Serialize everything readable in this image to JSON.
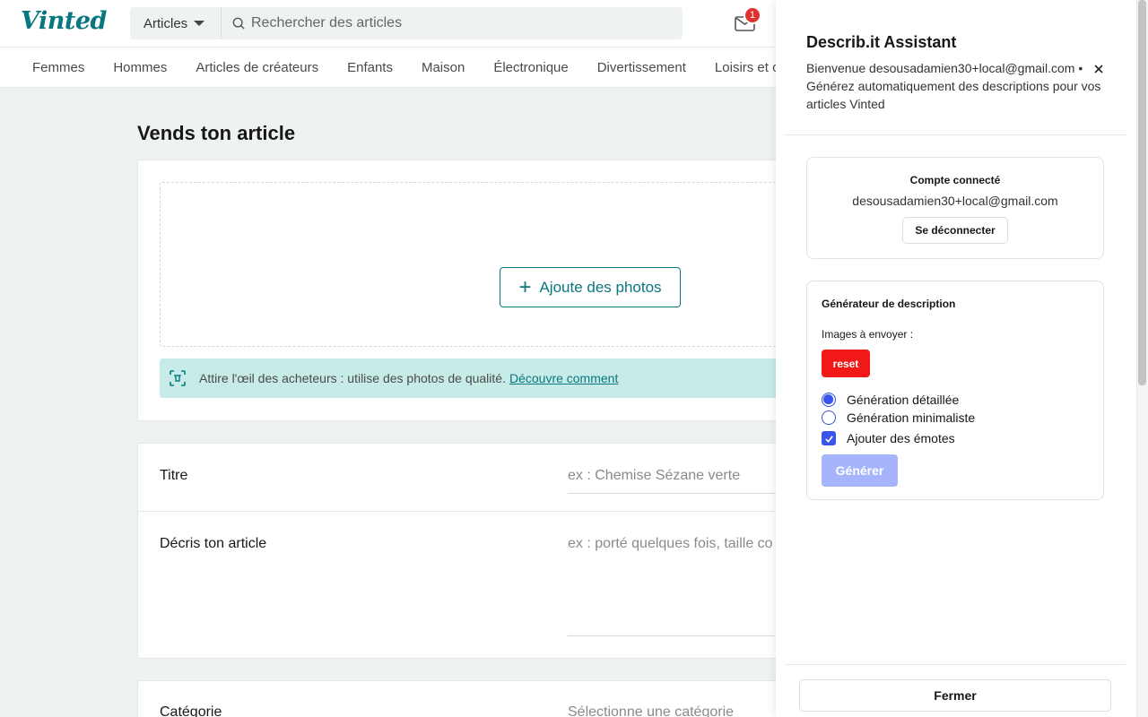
{
  "header": {
    "logo": "Vinted",
    "search_category": "Articles",
    "search_placeholder": "Rechercher des articles",
    "inbox_badge": "1"
  },
  "nav": {
    "items": [
      "Femmes",
      "Hommes",
      "Articles de créateurs",
      "Enfants",
      "Maison",
      "Électronique",
      "Divertissement",
      "Loisirs et coll"
    ]
  },
  "main": {
    "title": "Vends ton article",
    "add_photos": "Ajoute des photos",
    "tip_text": "Attire l'œil des acheteurs : utilise des photos de qualité.",
    "tip_link": "Découvre comment",
    "title_label": "Titre",
    "title_placeholder": "ex : Chemise Sézane verte",
    "desc_label": "Décris ton article",
    "desc_placeholder": "ex : porté quelques fois, taille co",
    "category_label": "Catégorie",
    "category_placeholder": "Sélectionne une catégorie"
  },
  "panel": {
    "title": "Describ.it Assistant",
    "welcome": "Bienvenue desousadamien30+local@gmail.com • Générez automatiquement des descriptions pour vos articles Vinted",
    "account_title": "Compte connecté",
    "account_email": "desousadamien30+local@gmail.com",
    "logout": "Se déconnecter",
    "generator_title": "Générateur de description",
    "images_label": "Images à envoyer :",
    "reset": "reset",
    "option_detailed": "Génération détaillée",
    "option_minimal": "Génération minimaliste",
    "option_emotes": "Ajouter des émotes",
    "generate": "Générer",
    "close": "Fermer"
  },
  "colors": {
    "brand": "#09777f",
    "accent": "#3a56ea",
    "reset": "#f21818",
    "badge": "#e0312f"
  },
  "icons": [
    "search-icon",
    "inbox-icon",
    "plus-icon",
    "photo-tip-icon",
    "close-icon",
    "check-icon"
  ]
}
